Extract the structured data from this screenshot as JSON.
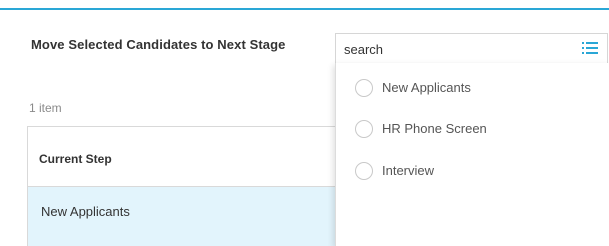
{
  "form": {
    "field_label": "Move Selected Candidates to Next Stage",
    "item_count": "1 item"
  },
  "grid": {
    "column_header": "Current Step",
    "rows": [
      {
        "current_step": "New Applicants"
      }
    ]
  },
  "search": {
    "placeholder": "search",
    "value": "",
    "icon": "list-icon"
  },
  "dropdown": {
    "options": [
      {
        "label": "New Applicants",
        "selected": false
      },
      {
        "label": "HR Phone Screen",
        "selected": false
      },
      {
        "label": "Interview",
        "selected": false
      }
    ]
  },
  "colors": {
    "accent": "#2aa7d6",
    "selected_row": "#e2f4fc",
    "border": "#d9d9d9"
  }
}
